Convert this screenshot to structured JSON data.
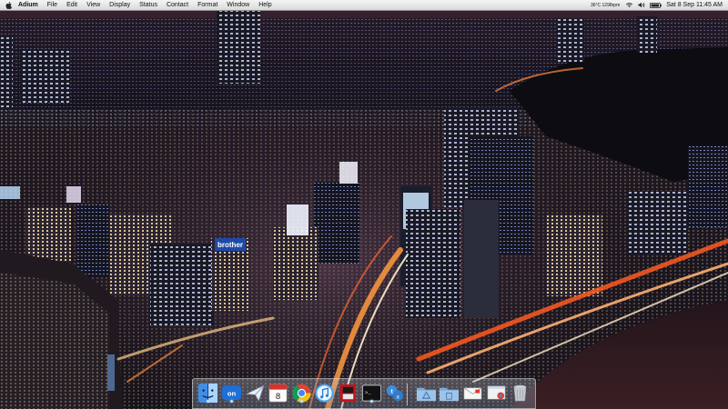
{
  "menubar": {
    "app_name": "Adium",
    "menus": [
      "File",
      "Edit",
      "View",
      "Display",
      "Status",
      "Contact",
      "Format",
      "Window",
      "Help"
    ],
    "temperature": "36°C 1298rpm",
    "clock": "Sat 8 Sep  11:45 AM",
    "status_icons": [
      "wifi-icon",
      "volume-icon",
      "battery-icon"
    ]
  },
  "wallpaper": {
    "billboard_text": "brother"
  },
  "dock": {
    "calendar_day": "8",
    "terminal_prompt": ">_",
    "twitter_glyph": "t",
    "apps": [
      "finder-icon",
      "adium-icon",
      "mail-icon",
      "calendar-icon",
      "chrome-icon",
      "itunes-icon",
      "photo-booth-icon",
      "terminal-icon",
      "twitter-icon",
      "applications-folder-icon",
      "documents-folder-icon",
      "mail-document-icon",
      "chrome-document-icon",
      "trash-icon"
    ]
  },
  "colors": {
    "sky": "#1b0f18",
    "city_glow": "#7a4a6a",
    "street_light": "#ff9a40",
    "menu_bar": "#e8e8e8"
  }
}
